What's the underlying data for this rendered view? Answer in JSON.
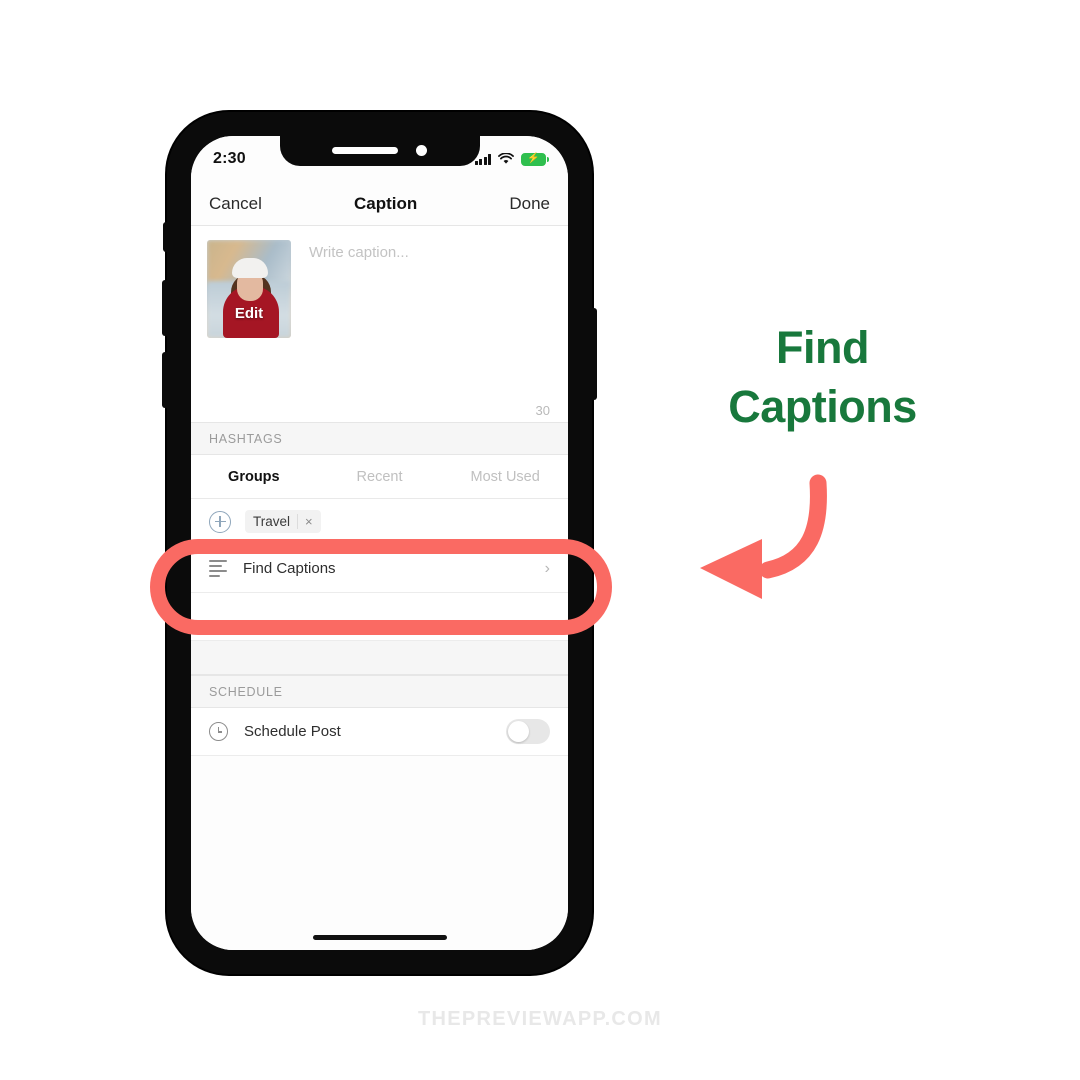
{
  "annotation": {
    "headline_line1": "Find",
    "headline_line2": "Captions",
    "headline_color": "#18783c",
    "arrow_color": "#fa6a63",
    "highlight_color": "#fa6a63",
    "arrow_icon": "curved-arrow-left-icon"
  },
  "watermark": "THEPREVIEWAPP.COM",
  "phone": {
    "status_bar": {
      "time": "2:30",
      "signal_icon": "cellular-signal-icon",
      "wifi_icon": "wifi-icon",
      "battery_icon": "battery-charging-icon",
      "battery_color": "#2fbf4e",
      "bolt_glyph": "⚡"
    },
    "nav_bar": {
      "cancel_label": "Cancel",
      "title": "Caption",
      "done_label": "Done"
    },
    "caption": {
      "thumbnail_name": "post-thumbnail",
      "edit_label": "Edit",
      "placeholder": "Write caption...",
      "char_count": "30"
    },
    "hashtags": {
      "section_label": "HASHTAGS",
      "tabs": [
        {
          "label": "Groups",
          "active": true
        },
        {
          "label": "Recent",
          "active": false
        },
        {
          "label": "Most Used",
          "active": false
        }
      ],
      "add_icon": "plus-circle-icon",
      "chips": [
        {
          "label": "Travel",
          "remove_glyph": "×"
        }
      ]
    },
    "rows": [
      {
        "label": "Find Captions",
        "icon": "text-lines-icon",
        "chevron": "›"
      }
    ],
    "schedule": {
      "section_label": "SCHEDULE",
      "row_label": "Schedule Post",
      "icon": "clock-icon",
      "toggle_state": "off"
    }
  }
}
